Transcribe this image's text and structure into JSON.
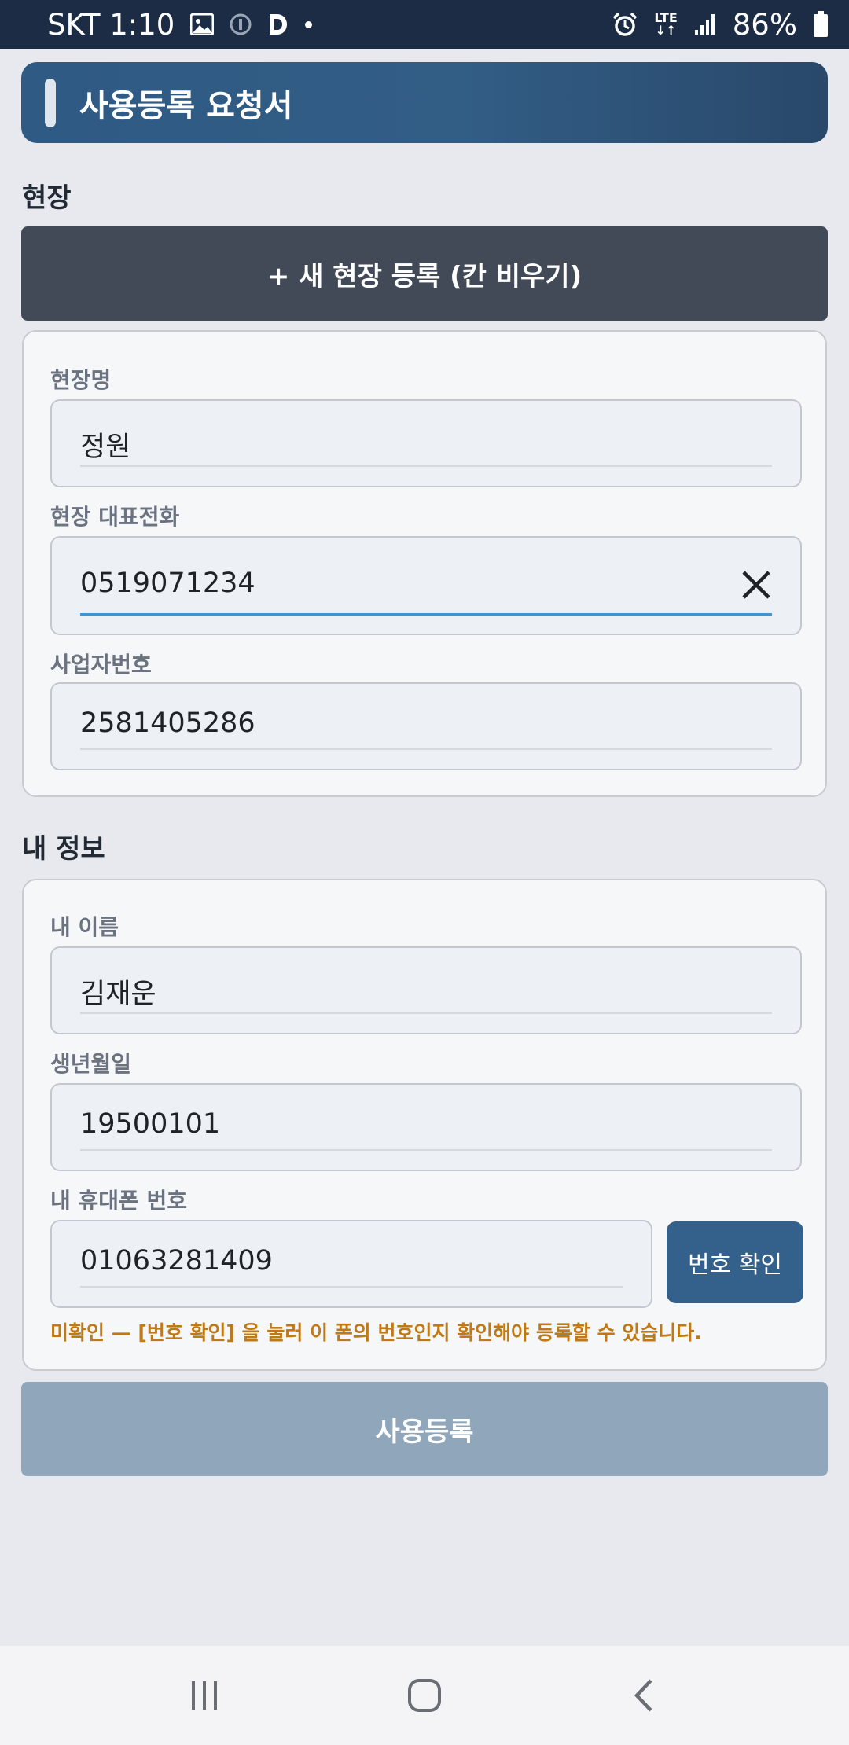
{
  "status_bar": {
    "carrier_time": "SKT 1:10",
    "network": "LTE",
    "battery": "86%",
    "icons": [
      "image-icon",
      "info-icon",
      "d-app-icon",
      "notification-dot-icon",
      "alarm-icon",
      "lte-icon",
      "signal-icon",
      "battery-icon"
    ]
  },
  "header": {
    "title": "사용등록 요청서"
  },
  "site_section": {
    "title": "현장",
    "new_site_button": "+ 새 현장 등록 (칸 비우기)",
    "fields": [
      {
        "label": "현장명",
        "value": "정원"
      },
      {
        "label": "현장 대표전화",
        "value": "0519071234",
        "focused": true
      },
      {
        "label": "사업자번호",
        "value": "2581405286"
      }
    ]
  },
  "my_info_section": {
    "title": "내 정보",
    "fields": [
      {
        "label": "내 이름",
        "value": "김재운"
      },
      {
        "label": "생년월일",
        "value": "19500101"
      },
      {
        "label": "내 휴대폰 번호",
        "value": "01063281409"
      }
    ],
    "verify_button": "번호 확인",
    "warning": "미확인 — [번호 확인] 을 눌러 이 폰의 번호인지 확인해야 등록할 수 있습니다."
  },
  "register_button": "사용등록",
  "colors": {
    "header_bg": "#325d85",
    "new_site_bg": "#434a57",
    "verify_bg": "#34608c",
    "warning": "#bf7a17",
    "register_disabled": "#8fa6bb",
    "focus_line": "#3d96d1"
  }
}
